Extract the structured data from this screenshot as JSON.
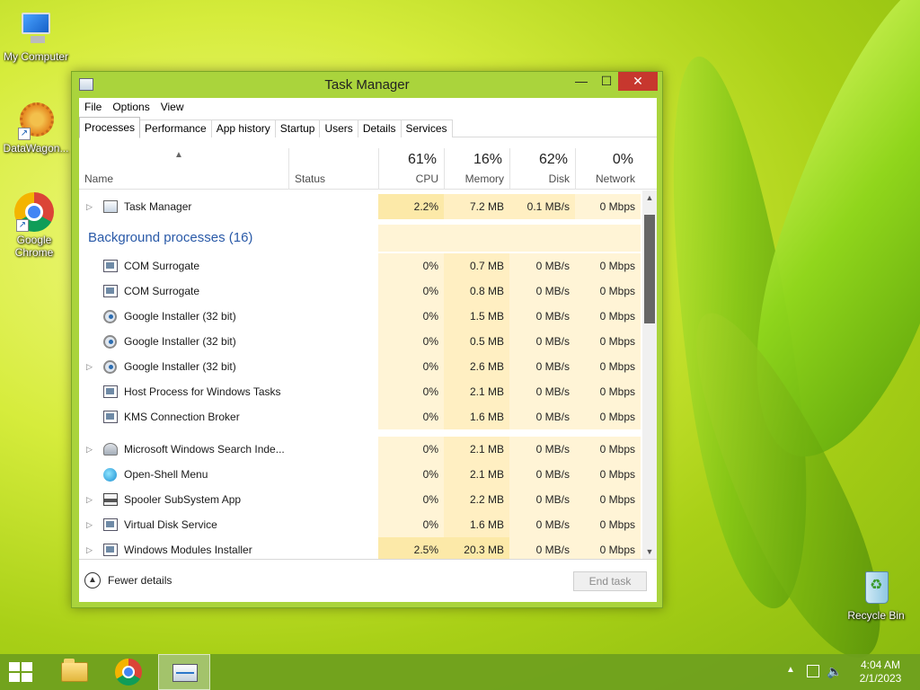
{
  "desktop": {
    "icons": [
      {
        "label": "My Computer"
      },
      {
        "label": "DataWagon..."
      },
      {
        "label": "Google Chrome"
      },
      {
        "label": "Recycle Bin"
      }
    ]
  },
  "window": {
    "title": "Task Manager",
    "controls": {
      "minimize": "—",
      "maximize": "☐",
      "close": "✕"
    },
    "menu": [
      "File",
      "Options",
      "View"
    ],
    "tabs": [
      "Processes",
      "Performance",
      "App history",
      "Startup",
      "Users",
      "Details",
      "Services"
    ],
    "active_tab": "Processes"
  },
  "columns": {
    "name": "Name",
    "status": "Status",
    "cpu": {
      "label": "CPU",
      "pct": "61%"
    },
    "memory": {
      "label": "Memory",
      "pct": "16%"
    },
    "disk": {
      "label": "Disk",
      "pct": "62%"
    },
    "network": {
      "label": "Network",
      "pct": "0%"
    }
  },
  "rows": [
    {
      "name": "Task Manager",
      "cpu": "2.2%",
      "mem": "7.2 MB",
      "disk": "0.1 MB/s",
      "net": "0 Mbps"
    }
  ],
  "group": {
    "title": "Background processes (16)"
  },
  "bg_rows": [
    {
      "name": "COM Surrogate",
      "cpu": "0%",
      "mem": "0.7 MB",
      "disk": "0 MB/s",
      "net": "0 Mbps"
    },
    {
      "name": "COM Surrogate",
      "cpu": "0%",
      "mem": "0.8 MB",
      "disk": "0 MB/s",
      "net": "0 Mbps"
    },
    {
      "name": "Google Installer (32 bit)",
      "cpu": "0%",
      "mem": "1.5 MB",
      "disk": "0 MB/s",
      "net": "0 Mbps"
    },
    {
      "name": "Google Installer (32 bit)",
      "cpu": "0%",
      "mem": "0.5 MB",
      "disk": "0 MB/s",
      "net": "0 Mbps"
    },
    {
      "name": "Google Installer (32 bit)",
      "cpu": "0%",
      "mem": "2.6 MB",
      "disk": "0 MB/s",
      "net": "0 Mbps"
    },
    {
      "name": "Host Process for Windows Tasks",
      "cpu": "0%",
      "mem": "2.1 MB",
      "disk": "0 MB/s",
      "net": "0 Mbps"
    },
    {
      "name": "KMS Connection Broker",
      "cpu": "0%",
      "mem": "1.6 MB",
      "disk": "0 MB/s",
      "net": "0 Mbps"
    },
    {
      "name": "Microsoft Windows Search Inde...",
      "cpu": "0%",
      "mem": "2.1 MB",
      "disk": "0 MB/s",
      "net": "0 Mbps"
    },
    {
      "name": "Open-Shell Menu",
      "cpu": "0%",
      "mem": "2.1 MB",
      "disk": "0 MB/s",
      "net": "0 Mbps"
    },
    {
      "name": "Spooler SubSystem App",
      "cpu": "0%",
      "mem": "2.2 MB",
      "disk": "0 MB/s",
      "net": "0 Mbps"
    },
    {
      "name": "Virtual Disk Service",
      "cpu": "0%",
      "mem": "1.6 MB",
      "disk": "0 MB/s",
      "net": "0 Mbps"
    },
    {
      "name": "Windows Modules Installer",
      "cpu": "2.5%",
      "mem": "20.3 MB",
      "disk": "0 MB/s",
      "net": "0 Mbps"
    }
  ],
  "footer": {
    "fewer_details": "Fewer details",
    "end_task": "End task"
  },
  "taskbar": {
    "time": "4:04 AM",
    "date": "2/1/2023"
  },
  "colors": {
    "accent": "#aad43c",
    "group_header": "#2a5aa8",
    "close": "#c7372e"
  }
}
